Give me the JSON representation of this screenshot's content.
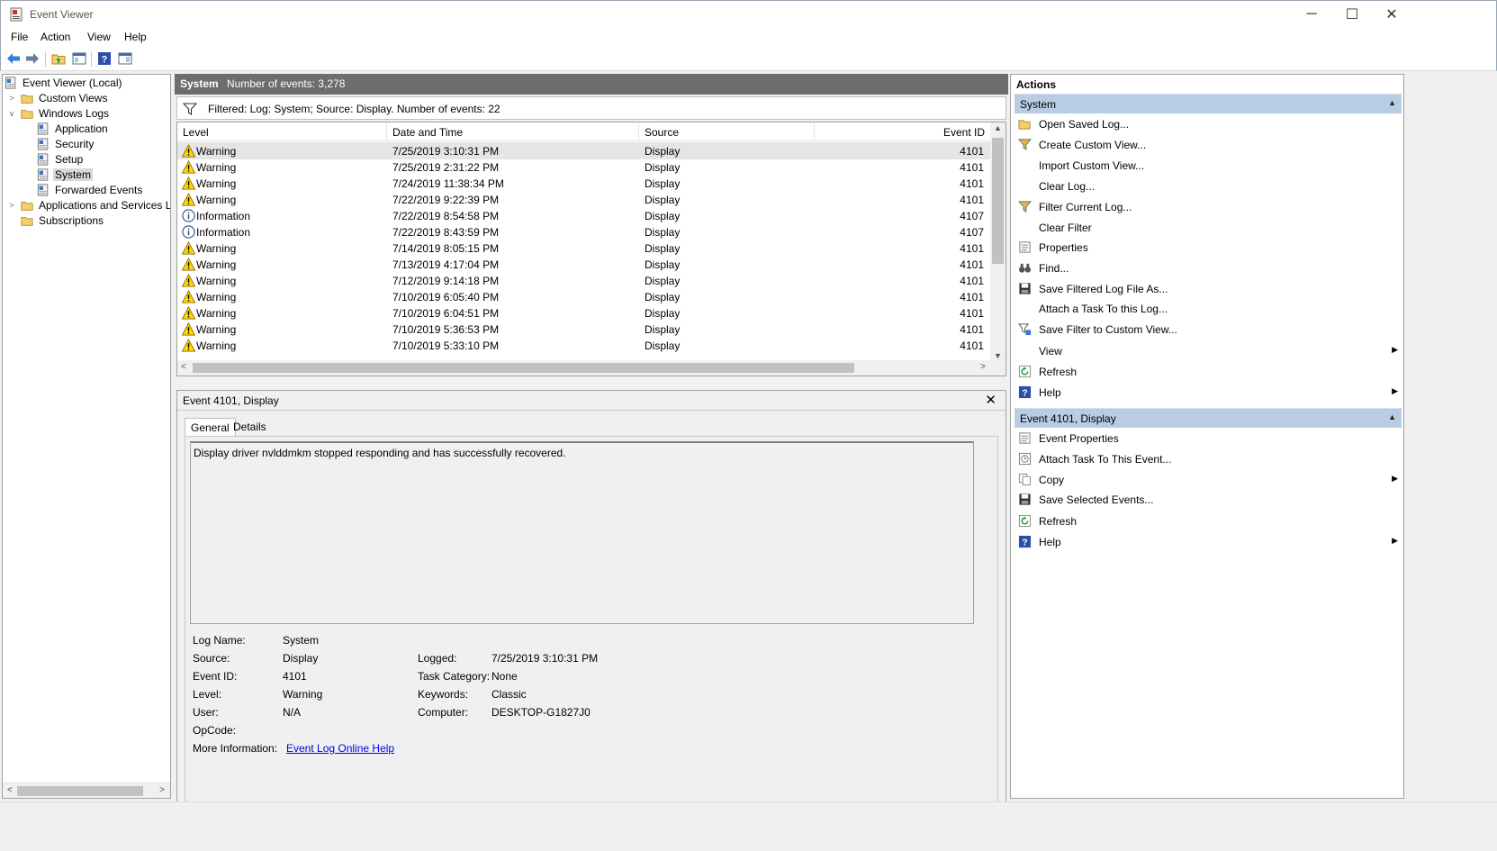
{
  "window": {
    "title": "Event Viewer"
  },
  "menu": [
    "File",
    "Action",
    "View",
    "Help"
  ],
  "tree": {
    "root": "Event Viewer (Local)",
    "custom_views": "Custom Views",
    "windows_logs": "Windows Logs",
    "application": "Application",
    "security": "Security",
    "setup": "Setup",
    "system": "System",
    "forwarded": "Forwarded Events",
    "apps_services": "Applications and Services Lo",
    "subscriptions": "Subscriptions"
  },
  "center": {
    "log_name": "System",
    "event_count": "Number of events: 3,278",
    "filter_text": "Filtered: Log: System; Source: Display. Number of events: 22",
    "columns": [
      "Level",
      "Date and Time",
      "Source",
      "Event ID"
    ],
    "rows": [
      {
        "level": "Warning",
        "date": "7/25/2019 3:10:31 PM",
        "source": "Display",
        "id": "4101"
      },
      {
        "level": "Warning",
        "date": "7/25/2019 2:31:22 PM",
        "source": "Display",
        "id": "4101"
      },
      {
        "level": "Warning",
        "date": "7/24/2019 11:38:34 PM",
        "source": "Display",
        "id": "4101"
      },
      {
        "level": "Warning",
        "date": "7/22/2019 9:22:39 PM",
        "source": "Display",
        "id": "4101"
      },
      {
        "level": "Information",
        "date": "7/22/2019 8:54:58 PM",
        "source": "Display",
        "id": "4107"
      },
      {
        "level": "Information",
        "date": "7/22/2019 8:43:59 PM",
        "source": "Display",
        "id": "4107"
      },
      {
        "level": "Warning",
        "date": "7/14/2019 8:05:15 PM",
        "source": "Display",
        "id": "4101"
      },
      {
        "level": "Warning",
        "date": "7/13/2019 4:17:04 PM",
        "source": "Display",
        "id": "4101"
      },
      {
        "level": "Warning",
        "date": "7/12/2019 9:14:18 PM",
        "source": "Display",
        "id": "4101"
      },
      {
        "level": "Warning",
        "date": "7/10/2019 6:05:40 PM",
        "source": "Display",
        "id": "4101"
      },
      {
        "level": "Warning",
        "date": "7/10/2019 6:04:51 PM",
        "source": "Display",
        "id": "4101"
      },
      {
        "level": "Warning",
        "date": "7/10/2019 5:36:53 PM",
        "source": "Display",
        "id": "4101"
      },
      {
        "level": "Warning",
        "date": "7/10/2019 5:33:10 PM",
        "source": "Display",
        "id": "4101"
      }
    ]
  },
  "detail": {
    "title": "Event 4101, Display",
    "tab_general": "General",
    "tab_details": "Details",
    "message": "Display driver nvlddmkm stopped responding and has successfully recovered.",
    "labels": {
      "log_name": "Log Name:",
      "source": "Source:",
      "event_id": "Event ID:",
      "level": "Level:",
      "user": "User:",
      "opcode": "OpCode:",
      "more_info": "More Information:",
      "logged": "Logged:",
      "task_category": "Task Category:",
      "keywords": "Keywords:",
      "computer": "Computer:"
    },
    "values": {
      "log_name": "System",
      "source": "Display",
      "event_id": "4101",
      "level": "Warning",
      "user": "N/A",
      "logged": "7/25/2019 3:10:31 PM",
      "task_category": "None",
      "keywords": "Classic",
      "computer": "DESKTOP-G1827J0",
      "more_info_link": "Event Log Online Help"
    }
  },
  "actions": {
    "title": "Actions",
    "group1": "System",
    "group1_items": [
      "Open Saved Log...",
      "Create Custom View...",
      "Import Custom View...",
      "Clear Log...",
      "Filter Current Log...",
      "Clear Filter",
      "Properties",
      "Find...",
      "Save Filtered Log File As...",
      "Attach a Task To this Log...",
      "Save Filter to Custom View...",
      "View",
      "Refresh",
      "Help"
    ],
    "group2": "Event 4101, Display",
    "group2_items": [
      "Event Properties",
      "Attach Task To This Event...",
      "Copy",
      "Save Selected Events...",
      "Refresh",
      "Help"
    ]
  },
  "colors": {
    "group_header": "#b8cde3",
    "pane_header": "#6d6d6d",
    "link": "#0000ee"
  }
}
